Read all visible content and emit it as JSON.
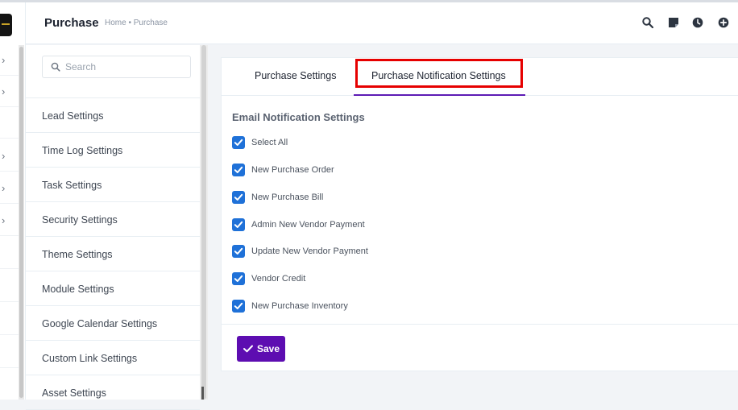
{
  "header": {
    "title": "Purchase",
    "breadcrumb": "Home • Purchase",
    "icons": [
      "search-icon",
      "sticky-note-icon",
      "clock-icon",
      "plus-circle-icon"
    ]
  },
  "sidebar": {
    "logo": "app-logo"
  },
  "settings_menu": {
    "search_placeholder": "Search",
    "items": [
      {
        "label": "Lead Settings"
      },
      {
        "label": "Time Log Settings"
      },
      {
        "label": "Task Settings"
      },
      {
        "label": "Security Settings"
      },
      {
        "label": "Theme Settings"
      },
      {
        "label": "Module Settings"
      },
      {
        "label": "Google Calendar Settings"
      },
      {
        "label": "Custom Link Settings"
      },
      {
        "label": "Asset Settings"
      }
    ]
  },
  "tabs": [
    {
      "label": "Purchase Settings",
      "active": false
    },
    {
      "label": "Purchase Notification Settings",
      "active": true
    }
  ],
  "section": {
    "title": "Email Notification Settings",
    "options": [
      {
        "label": "Select All",
        "checked": true
      },
      {
        "label": "New Purchase Order",
        "checked": true
      },
      {
        "label": "New Purchase Bill",
        "checked": true
      },
      {
        "label": "Admin New Vendor Payment",
        "checked": true
      },
      {
        "label": "Update New Vendor Payment",
        "checked": true
      },
      {
        "label": "Vendor Credit",
        "checked": true
      },
      {
        "label": "New Purchase Inventory",
        "checked": true
      }
    ]
  },
  "actions": {
    "save_label": "Save"
  },
  "colors": {
    "accent": "#5d0db1",
    "checkbox": "#1f71d8",
    "highlight": "#e60000"
  }
}
